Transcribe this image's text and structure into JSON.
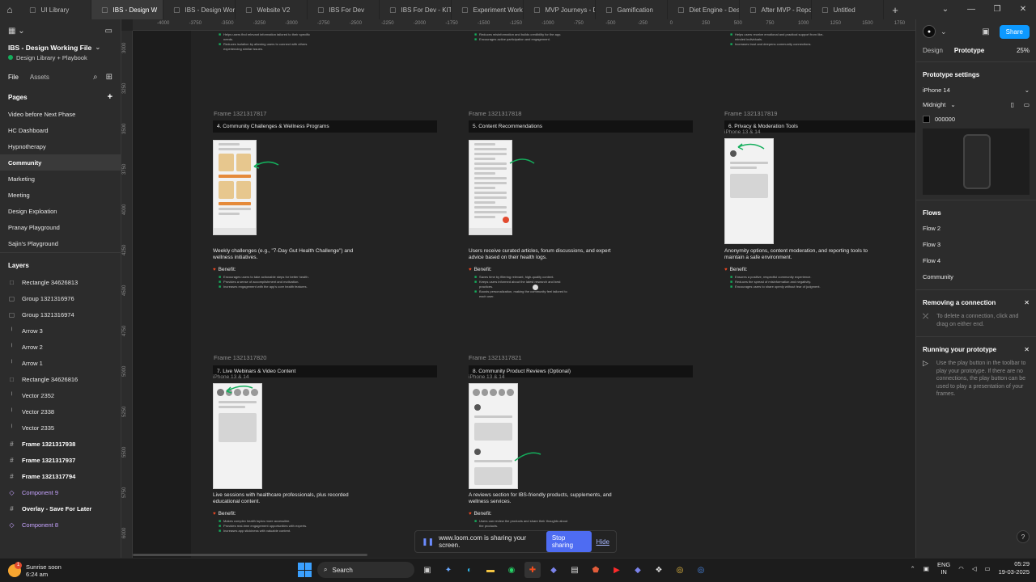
{
  "tabs": [
    {
      "label": "UI Library",
      "active": false
    },
    {
      "label": "IBS - Design W",
      "active": true
    },
    {
      "label": "IBS - Design Work",
      "active": false
    },
    {
      "label": "Website V2",
      "active": false
    },
    {
      "label": "IBS For Dev",
      "active": false
    },
    {
      "label": "IBS For Dev - KIT",
      "active": false
    },
    {
      "label": "Experiment Worki",
      "active": false
    },
    {
      "label": "MVP Journeys - D",
      "active": false
    },
    {
      "label": "Gamification",
      "active": false
    },
    {
      "label": "Diet Engine - Desi",
      "active": false
    },
    {
      "label": "After MVP - Repo",
      "active": false
    },
    {
      "label": "Untitled",
      "active": false
    }
  ],
  "project": {
    "title": "IBS - Design Working File",
    "subtitle": "Design Library + Playbook"
  },
  "left_tabs": {
    "file": "File",
    "assets": "Assets"
  },
  "pages_heading": "Pages",
  "pages": [
    {
      "label": "Video before Next Phase",
      "active": false
    },
    {
      "label": "HC Dashboard",
      "active": false
    },
    {
      "label": "Hypnotherapy",
      "active": false
    },
    {
      "label": "Community",
      "active": true
    },
    {
      "label": "Marketing",
      "active": false
    },
    {
      "label": "Meeting",
      "active": false
    },
    {
      "label": "Design Exploation",
      "active": false
    },
    {
      "label": "Pranay Playground",
      "active": false
    },
    {
      "label": "Sajin's Playground",
      "active": false
    },
    {
      "label": "F2 meetings",
      "active": false
    }
  ],
  "layers_heading": "Layers",
  "layers": [
    {
      "label": "Rectangle 34626813",
      "type": "rect"
    },
    {
      "label": "Group 1321316976",
      "type": "group"
    },
    {
      "label": "Group 1321316974",
      "type": "group"
    },
    {
      "label": "Arrow 3",
      "type": "line"
    },
    {
      "label": "Arrow 2",
      "type": "line"
    },
    {
      "label": "Arrow 1",
      "type": "line"
    },
    {
      "label": "Rectangle 34626816",
      "type": "rect"
    },
    {
      "label": "Vector 2352",
      "type": "line"
    },
    {
      "label": "Vector 2338",
      "type": "line"
    },
    {
      "label": "Vector 2335",
      "type": "line"
    },
    {
      "label": "Frame 1321317938",
      "type": "frame"
    },
    {
      "label": "Frame 1321317937",
      "type": "frame"
    },
    {
      "label": "Frame 1321317794",
      "type": "frame"
    },
    {
      "label": "Component 9",
      "type": "comp"
    },
    {
      "label": "Overlay - Save For Later",
      "type": "frame"
    },
    {
      "label": "Component 8",
      "type": "comp"
    }
  ],
  "ruler_top": [
    "-4000",
    "-3750",
    "-3500",
    "-3250",
    "-3000",
    "-2750",
    "-2500",
    "-2250",
    "-2000",
    "-1750",
    "-1500",
    "-1250",
    "-1000",
    "-750",
    "-500",
    "-250",
    "0",
    "250",
    "500",
    "750",
    "1000",
    "1250",
    "1500",
    "1750"
  ],
  "ruler_left": [
    "3000",
    "3250",
    "3500",
    "3750",
    "4000",
    "4250",
    "4500",
    "4750",
    "5000",
    "5250",
    "5500",
    "5750",
    "6000",
    "6250"
  ],
  "frames": [
    {
      "frame": "Frame 1321317817",
      "title": "4. Community Challenges & Wellness Programs",
      "iphone": "",
      "desc": "Weekly challenges (e.g., \"7-Day Gut Health Challenge\") and wellness initiatives.",
      "benefit": "Benefit:",
      "bullets": [
        "Encourages users to take actionable steps for better health.",
        "Provides a sense of accomplishment and motivation.",
        "Increases engagement with the app's core health features."
      ]
    },
    {
      "frame": "Frame 1321317818",
      "title": "5. Content Recommendations",
      "iphone": "",
      "desc": "Users receive curated articles, forum discussions, and expert advice based on their health logs.",
      "benefit": "Benefit:",
      "bullets": [
        "Saves time by filtering relevant, high-quality content.",
        "Keeps users informed about the latest research and best practices.",
        "Boosts personalization, making the community feel tailored to each user."
      ]
    },
    {
      "frame": "Frame 1321317819",
      "title": "6. Privacy & Moderation Tools",
      "iphone": "iPhone 13 & 14",
      "desc": "Anonymity options, content moderation, and reporting tools to maintain a safe environment.",
      "benefit": "Benefit:",
      "bullets": [
        "Ensures a positive, respectful community experience.",
        "Reduces the spread of misinformation and negativity.",
        "Encourages users to share openly without fear of judgment."
      ]
    },
    {
      "frame": "Frame 1321317820",
      "title": "7. Live Webinars & Video Content",
      "iphone": "iPhone 13 & 14",
      "desc": "Live sessions with healthcare professionals, plus recorded educational content.",
      "benefit": "Benefit:",
      "bullets": [
        "Makes complex health topics more accessible.",
        "Provides real-time engagement opportunities with experts.",
        "Increases app stickiness with valuable content."
      ]
    },
    {
      "frame": "Frame 1321317821",
      "title": "8. Community Product Reviews (Optional)",
      "iphone": "iPhone 13 & 14",
      "desc": "A reviews section for IBS-friendly products, supplements, and wellness services.",
      "benefit": "Benefit:",
      "bullets": [
        "Users can review the products and share their thoughts about the products."
      ]
    }
  ],
  "top_partial": [
    [
      "Helps users find relevant information tailored to their specific needs.",
      "Reduces isolation by allowing users to connect with others experiencing similar issues."
    ],
    [
      "Reduces misinformation and builds credibility for the app.",
      "Encourages active participation and engagement."
    ],
    [
      "Helps users receive emotional and practical support from like-minded individuals.",
      "Increases trust and deepens community connections."
    ]
  ],
  "loom": {
    "text": "www.loom.com is sharing your screen.",
    "stop": "Stop sharing",
    "hide": "Hide"
  },
  "right": {
    "share": "Share",
    "tab_design": "Design",
    "tab_prototype": "Prototype",
    "zoom": "25%",
    "proto_heading": "Prototype settings",
    "device": "iPhone 14",
    "model": "Midnight",
    "bg_color": "000000",
    "flows_heading": "Flows",
    "flows": [
      "Flow 2",
      "Flow 3",
      "Flow 4",
      "Community"
    ],
    "remove_heading": "Removing a connection",
    "remove_tip": "To delete a connection, click and drag on either end.",
    "run_heading": "Running your prototype",
    "run_tip": "Use the play button in the toolbar to play your prototype. If there are no connections, the play button can be used to play a presentation of your frames."
  },
  "taskbar": {
    "weather_title": "Sunrise soon",
    "weather_time": "6:24 am",
    "weather_badge": "1",
    "search": "Search",
    "lang1": "ENG",
    "lang2": "IN",
    "time": "05:29",
    "date": "19-03-2025"
  },
  "colors": {
    "accent": "#0d99ff",
    "loom": "#4e6cf2",
    "check": "#14ae5c",
    "heart": "#f24822"
  }
}
